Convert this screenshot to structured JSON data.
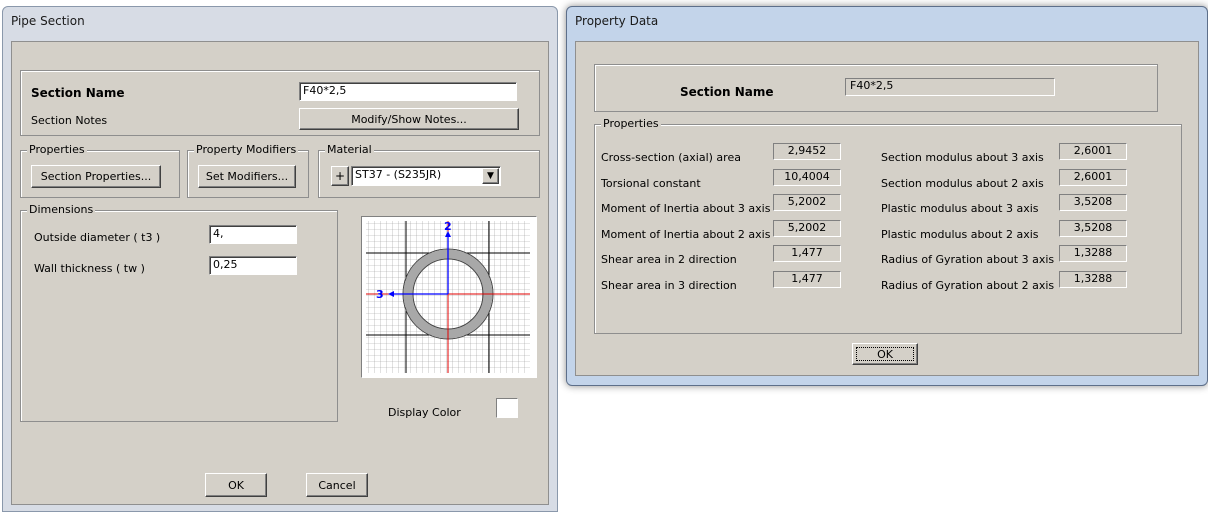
{
  "pipe": {
    "title": "Pipe Section",
    "section_name_label": "Section Name",
    "section_name_value": "F40*2,5",
    "section_notes_label": "Section Notes",
    "notes_button": "Modify/Show Notes...",
    "properties_group": "Properties",
    "section_props_button": "Section Properties...",
    "modifiers_group": "Property Modifiers",
    "set_modifiers_button": "Set Modifiers...",
    "material_group": "Material",
    "material_plus": "+",
    "material_value": "ST37 - (S235JR)",
    "dimensions_group": "Dimensions",
    "outside_diameter_label": "Outside diameter  ( t3 )",
    "outside_diameter_value": "4,",
    "wall_thickness_label": "Wall thickness  ( tw )",
    "wall_thickness_value": "0,25",
    "axis_2": "2",
    "axis_3": "3",
    "display_color_label": "Display Color",
    "ok": "OK",
    "cancel": "Cancel"
  },
  "property_data": {
    "title": "Property Data",
    "section_name_label": "Section Name",
    "section_name_value": "F40*2,5",
    "properties_group": "Properties",
    "left": [
      {
        "label": "Cross-section (axial) area",
        "value": "2,9452"
      },
      {
        "label": "Torsional constant",
        "value": "10,4004"
      },
      {
        "label": "Moment of Inertia about 3 axis",
        "value": "5,2002"
      },
      {
        "label": "Moment of Inertia about 2 axis",
        "value": "5,2002"
      },
      {
        "label": "Shear area in 2 direction",
        "value": "1,477"
      },
      {
        "label": "Shear area in 3 direction",
        "value": "1,477"
      }
    ],
    "right": [
      {
        "label": "Section modulus about 3 axis",
        "value": "2,6001"
      },
      {
        "label": "Section modulus about 2 axis",
        "value": "2,6001"
      },
      {
        "label": "Plastic modulus about 3 axis",
        "value": "3,5208"
      },
      {
        "label": "Plastic modulus about 2 axis",
        "value": "3,5208"
      },
      {
        "label": "Radius of Gyration about 3 axis",
        "value": "1,3288"
      },
      {
        "label": "Radius of Gyration about 2 axis",
        "value": "1,3288"
      }
    ],
    "ok": "OK"
  }
}
